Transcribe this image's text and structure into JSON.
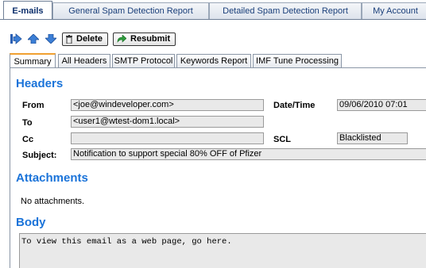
{
  "top_tabs": [
    {
      "label": "E-mails",
      "active": true
    },
    {
      "label": "General Spam Detection Report",
      "active": false
    },
    {
      "label": "Detailed Spam Detection Report",
      "active": false
    },
    {
      "label": "My Account",
      "active": false
    }
  ],
  "toolbar": {
    "delete_label": "Delete",
    "resubmit_label": "Resubmit"
  },
  "sub_tabs": [
    {
      "label": "Summary",
      "active": true
    },
    {
      "label": "All Headers",
      "active": false
    },
    {
      "label": "SMTP Protocol",
      "active": false
    },
    {
      "label": "Keywords Report",
      "active": false
    },
    {
      "label": "IMF Tune Processing",
      "active": false
    }
  ],
  "headers": {
    "title": "Headers",
    "from_label": "From",
    "from_value": "<joe@windeveloper.com>",
    "to_label": "To",
    "to_value": "<user1@wtest-dom1.local>",
    "cc_label": "Cc",
    "cc_value": "",
    "subject_label": "Subject:",
    "subject_value": "Notification to support special 80% OFF of Pfizer",
    "datetime_label": "Date/Time",
    "datetime_value": "09/06/2010 07:01",
    "scl_label": "SCL",
    "scl_value": "Blacklisted"
  },
  "attachments": {
    "title": "Attachments",
    "text": "No attachments."
  },
  "body": {
    "title": "Body",
    "text": "To view this email as a web page, go here."
  },
  "colors": {
    "section_heading": "#1a73d9",
    "active_subtab_accent": "#f0a030",
    "field_bg": "#e9e9e9"
  }
}
